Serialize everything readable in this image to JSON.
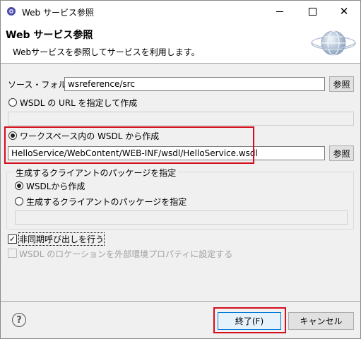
{
  "window": {
    "title": "Web サービス参照",
    "controls": {
      "minimize": "—",
      "maximize": "□",
      "close": "✕"
    }
  },
  "header": {
    "title": "Web サービス参照",
    "description": "Webサービスを参照してサービスを利用します。",
    "icon": "globe-icon"
  },
  "source_folder": {
    "label": "ソース・フォルダー:",
    "value": "wsreference/src",
    "browse_label": "参照"
  },
  "wsdl_url": {
    "label": "WSDL の URL を指定して作成",
    "selected": false,
    "value": ""
  },
  "workspace_wsdl": {
    "label": "ワークスペース内の WSDL から作成",
    "selected": true,
    "value": "HelloService/WebContent/WEB-INF/wsdl/HelloService.wsdl",
    "browse_label": "参照"
  },
  "client_package": {
    "group_title": "生成するクライアントのパッケージを指定",
    "from_wsdl_label": "WSDLから作成",
    "from_wsdl_selected": true,
    "specify_label": "生成するクライアントのパッケージを指定",
    "specify_selected": false,
    "value": ""
  },
  "async_call": {
    "label": "非同期呼び出しを行う",
    "checked": true
  },
  "wsdl_location": {
    "label": "WSDL のロケーションを外部環境プロパティに設定する",
    "checked": false,
    "disabled": true
  },
  "footer": {
    "help": "?",
    "finish_label": "終了(F)",
    "cancel_label": "キャンセル"
  },
  "colors": {
    "highlight": "#d40e1c",
    "accent": "#0078d7"
  }
}
